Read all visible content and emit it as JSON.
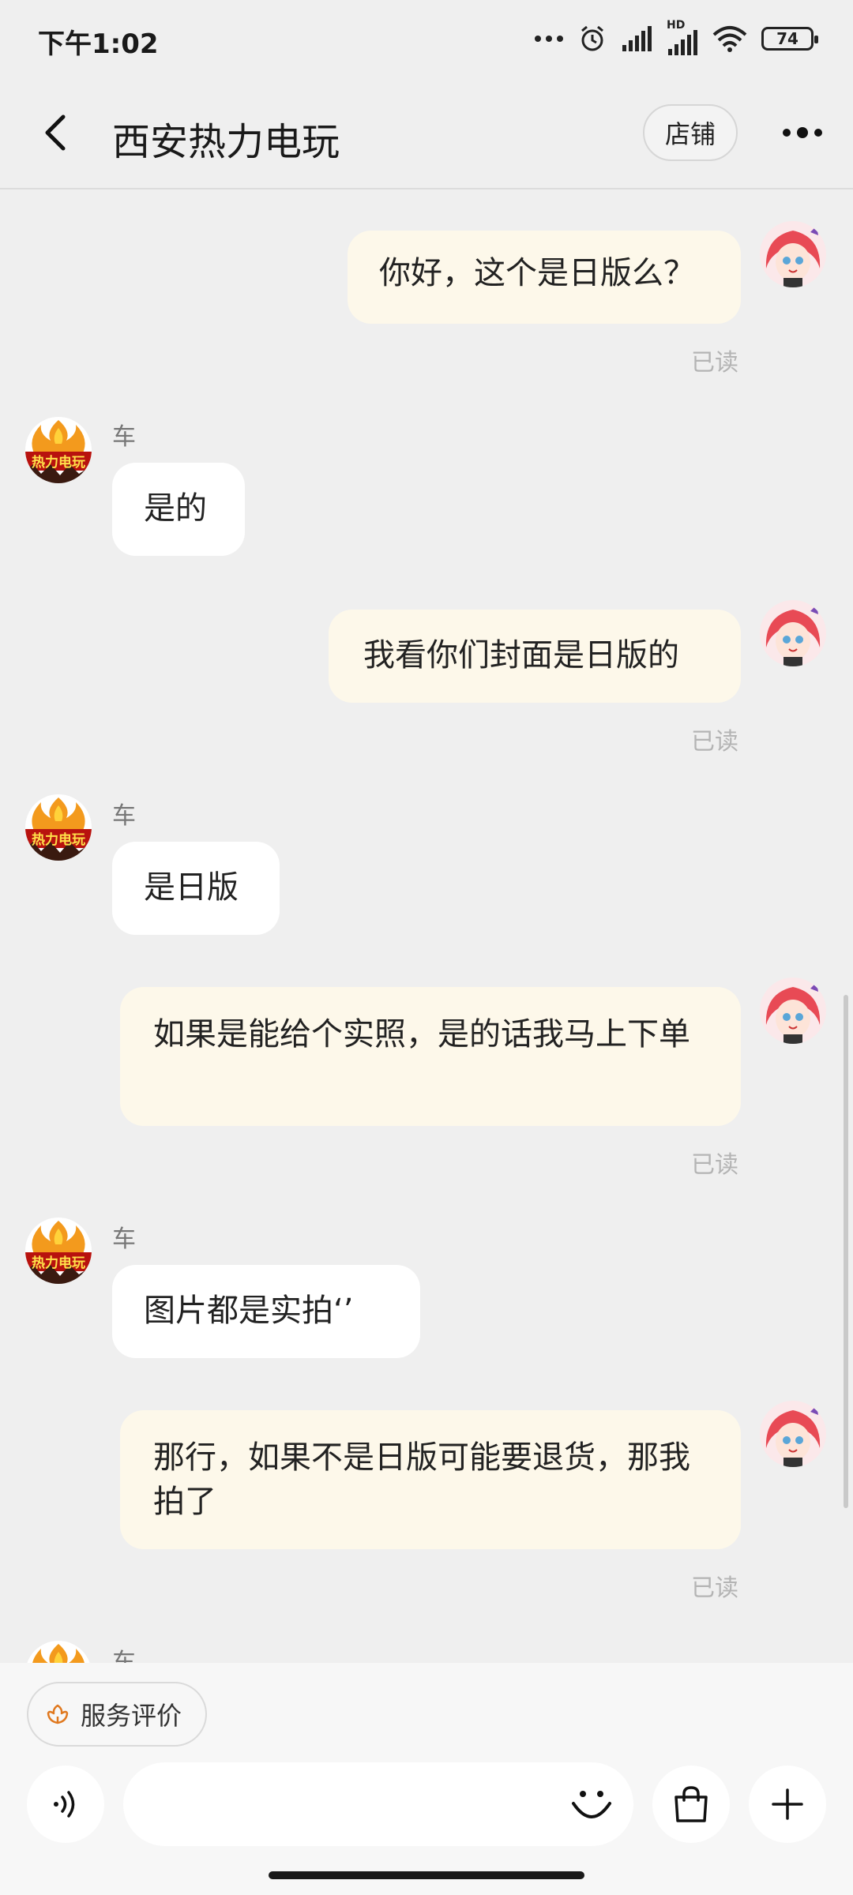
{
  "status_bar": {
    "time": "下午1:02",
    "battery": "74",
    "network_label": "HD"
  },
  "header": {
    "title": "西安热力电玩",
    "shop_label": "店铺"
  },
  "shop_logo_text": "热力电玩",
  "messages": [
    {
      "from": "me",
      "text": "你好，这个是日版么？",
      "status": "已读"
    },
    {
      "from": "shop",
      "sender": "车",
      "text": "是的"
    },
    {
      "from": "me",
      "text": "我看你们封面是日版的",
      "status": "已读"
    },
    {
      "from": "shop",
      "sender": "车",
      "text": "是日版"
    },
    {
      "from": "me",
      "text": "如果是能给个实照，是的话我马上下单",
      "status": "已读"
    },
    {
      "from": "shop",
      "sender": "车",
      "text": "图片都是实拍‘’"
    },
    {
      "from": "me",
      "text": "那行，如果不是日版可能要退货，那我拍了",
      "status": "已读"
    },
    {
      "from": "shop",
      "sender": "车",
      "text": ""
    }
  ],
  "bottom_bar": {
    "service_rating_label": "服务评价",
    "input_placeholder": ""
  },
  "colors": {
    "my_bubble": "#fdf8ea",
    "shop_bubble": "#ffffff",
    "background": "#efefef",
    "accent": "#e0781e"
  }
}
